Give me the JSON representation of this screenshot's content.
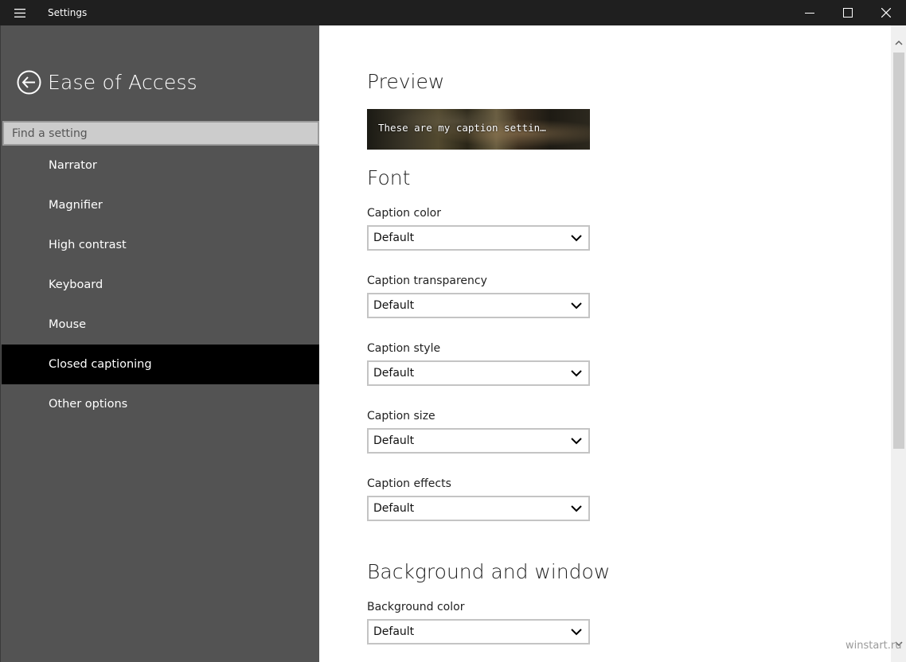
{
  "window": {
    "title": "Settings",
    "icons": {
      "menu": "hamburger-icon",
      "minimize": "minimize-icon",
      "maximize": "maximize-icon",
      "close": "close-icon"
    }
  },
  "sidebar": {
    "section_title": "Ease of Access",
    "back_icon": "back-arrow-icon",
    "search_placeholder": "Find a setting",
    "items": [
      {
        "label": "Narrator",
        "active": false
      },
      {
        "label": "Magnifier",
        "active": false
      },
      {
        "label": "High contrast",
        "active": false
      },
      {
        "label": "Keyboard",
        "active": false
      },
      {
        "label": "Mouse",
        "active": false
      },
      {
        "label": "Closed captioning",
        "active": true
      },
      {
        "label": "Other options",
        "active": false
      }
    ]
  },
  "main": {
    "preview": {
      "heading": "Preview",
      "caption_text": "These are my caption settin…"
    },
    "font": {
      "heading": "Font",
      "fields": [
        {
          "label": "Caption color",
          "value": "Default"
        },
        {
          "label": "Caption transparency",
          "value": "Default"
        },
        {
          "label": "Caption style",
          "value": "Default"
        },
        {
          "label": "Caption size",
          "value": "Default"
        },
        {
          "label": "Caption effects",
          "value": "Default"
        }
      ]
    },
    "background": {
      "heading": "Background and window",
      "fields": [
        {
          "label": "Background color",
          "value": "Default"
        }
      ]
    }
  },
  "watermark": "winstart.ru",
  "colors": {
    "titlebar": "#1f1f1f",
    "sidebar": "#535353",
    "active_item": "#000000",
    "content_bg": "#ffffff"
  }
}
